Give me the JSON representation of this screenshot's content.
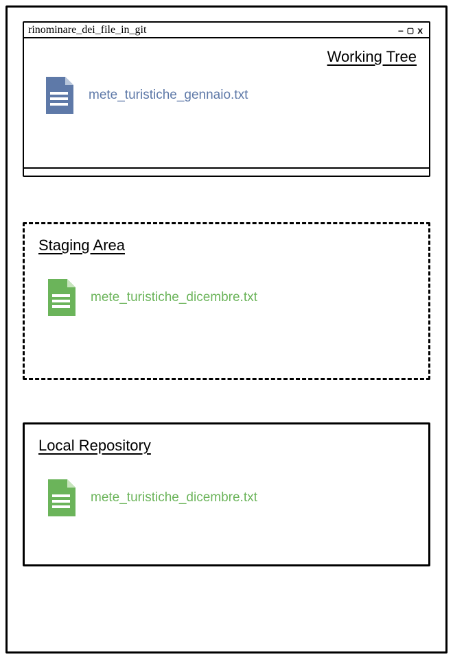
{
  "window": {
    "title": "rinominare_dei_file_in_git",
    "controls": "– ▢ x"
  },
  "working_tree": {
    "title": "Working Tree",
    "file": {
      "name": "mete_turistiche_gennaio.txt",
      "color": "#5e79a8"
    }
  },
  "staging_area": {
    "title": "Staging Area",
    "file": {
      "name": "mete_turistiche_dicembre.txt",
      "color": "#6bb45a"
    }
  },
  "local_repo": {
    "title": "Local Repository",
    "file": {
      "name": "mete_turistiche_dicembre.txt",
      "color": "#6bb45a"
    }
  },
  "colors": {
    "blue": "#5e79a8",
    "green": "#6bb45a"
  }
}
